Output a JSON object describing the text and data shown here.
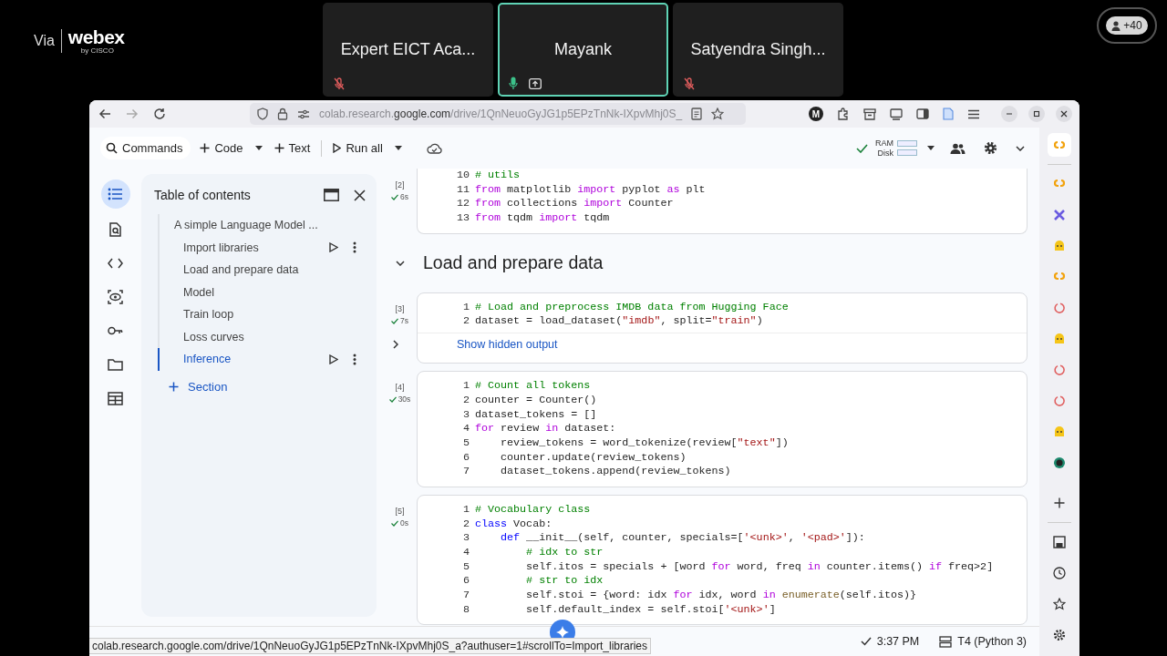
{
  "meeting": {
    "brand_prefix": "Via",
    "brand": "webex",
    "brand_sub": "by CISCO",
    "attendees_badge": "+40",
    "participants": [
      {
        "name": "Expert EICT Aca...",
        "muted": true,
        "speaking": false,
        "sharing": false
      },
      {
        "name": "Mayank",
        "muted": false,
        "speaking": true,
        "sharing": true
      },
      {
        "name": "Satyendra Singh...",
        "muted": true,
        "speaking": false,
        "sharing": false
      }
    ]
  },
  "browser": {
    "url": "colab.research.**google.com**/drive/1QnNeuoGyJG1p5EPzTnNk-IXpvMhj0S_",
    "profile_initial": "M",
    "status_link": "colab.research.google.com/drive/1QnNeuoGyJG1p5EPzTnNk-IXpvMhj0S_a?authuser=1#scrollTo=Import_libraries"
  },
  "toolbar": {
    "items": [
      {
        "kind": "search",
        "label": "Commands",
        "menu": false
      },
      {
        "kind": "add",
        "label": "Code",
        "menu": true
      },
      {
        "kind": "add",
        "label": "Text",
        "menu": false
      },
      {
        "kind": "run",
        "label": "Run all",
        "menu": true
      }
    ],
    "connected": true,
    "ram_label": "RAM",
    "disk_label": "Disk"
  },
  "sidebar": {
    "items": [
      {
        "kind": "toc",
        "selected": true
      },
      {
        "kind": "find",
        "selected": false
      },
      {
        "kind": "code",
        "selected": false
      },
      {
        "kind": "variables",
        "selected": false
      },
      {
        "kind": "secrets",
        "selected": false
      },
      {
        "kind": "files",
        "selected": false
      },
      {
        "kind": "data",
        "selected": false
      }
    ]
  },
  "toc": {
    "title": "Table of contents",
    "add_label": "Section",
    "items": [
      {
        "label": "A simple Language Model ...",
        "selected": false,
        "hovered": false,
        "children": [
          {
            "label": "Import libraries",
            "selected": false,
            "hovered": true
          },
          {
            "label": "Load and prepare data",
            "selected": false,
            "hovered": false
          },
          {
            "label": "Model",
            "selected": false,
            "hovered": false
          },
          {
            "label": "Train loop",
            "selected": false,
            "hovered": false
          },
          {
            "label": "Loss curves",
            "selected": false,
            "hovered": false
          },
          {
            "label": "Inference",
            "selected": true,
            "hovered": false
          }
        ]
      }
    ]
  },
  "notebook": {
    "blocks": [
      {
        "kind": "code",
        "count": "[2]",
        "time": "6s",
        "done": true,
        "lines": [
          {
            "number": "10",
            "tokens": [
              {
                "text": "# utils",
                "kind": "comment"
              }
            ]
          },
          {
            "number": "11",
            "tokens": [
              {
                "text": "from",
                "kind": "keyword"
              },
              {
                "text": " matplotlib ",
                "kind": "plain"
              },
              {
                "text": "import",
                "kind": "keyword"
              },
              {
                "text": " pyplot ",
                "kind": "plain"
              },
              {
                "text": "as",
                "kind": "keyword"
              },
              {
                "text": " plt",
                "kind": "plain"
              }
            ]
          },
          {
            "number": "12",
            "tokens": [
              {
                "text": "from",
                "kind": "keyword"
              },
              {
                "text": " collections ",
                "kind": "plain"
              },
              {
                "text": "import",
                "kind": "keyword"
              },
              {
                "text": " Counter",
                "kind": "plain"
              }
            ]
          },
          {
            "number": "13",
            "tokens": [
              {
                "text": "from",
                "kind": "keyword"
              },
              {
                "text": " tqdm ",
                "kind": "plain"
              },
              {
                "text": "import",
                "kind": "keyword"
              },
              {
                "text": " tqdm",
                "kind": "plain"
              }
            ]
          }
        ]
      },
      {
        "kind": "heading",
        "text": "Load and prepare data",
        "expanded": true
      },
      {
        "kind": "code",
        "count": "[3]",
        "time": "7s",
        "done": true,
        "hidden_output": "Show hidden output",
        "lines": [
          {
            "number": "1",
            "tokens": [
              {
                "text": "# Load and preprocess IMDB data from Hugging Face",
                "kind": "comment"
              }
            ]
          },
          {
            "number": "2",
            "tokens": [
              {
                "text": "dataset = load_dataset(",
                "kind": "plain"
              },
              {
                "text": "\"imdb\"",
                "kind": "string"
              },
              {
                "text": ", split=",
                "kind": "plain"
              },
              {
                "text": "\"train\"",
                "kind": "string"
              },
              {
                "text": ")",
                "kind": "plain"
              }
            ]
          }
        ]
      },
      {
        "kind": "code",
        "count": "[4]",
        "time": "30s",
        "done": true,
        "lines": [
          {
            "number": "1",
            "tokens": [
              {
                "text": "# Count all tokens",
                "kind": "comment"
              }
            ]
          },
          {
            "number": "2",
            "tokens": [
              {
                "text": "counter = Counter()",
                "kind": "plain"
              }
            ]
          },
          {
            "number": "3",
            "tokens": [
              {
                "text": "dataset_tokens = []",
                "kind": "plain"
              }
            ]
          },
          {
            "number": "4",
            "tokens": [
              {
                "text": "for",
                "kind": "keyword"
              },
              {
                "text": " review ",
                "kind": "plain"
              },
              {
                "text": "in",
                "kind": "keyword"
              },
              {
                "text": " dataset:",
                "kind": "plain"
              }
            ]
          },
          {
            "number": "5",
            "tokens": [
              {
                "text": "    review_tokens = word_tokenize(review[",
                "kind": "plain"
              },
              {
                "text": "\"text\"",
                "kind": "string"
              },
              {
                "text": "])",
                "kind": "plain"
              }
            ]
          },
          {
            "number": "6",
            "tokens": [
              {
                "text": "    counter.update(review_tokens)",
                "kind": "plain"
              }
            ]
          },
          {
            "number": "7",
            "tokens": [
              {
                "text": "    dataset_tokens.append(review_tokens)",
                "kind": "plain"
              }
            ]
          }
        ]
      },
      {
        "kind": "code",
        "count": "[5]",
        "time": "0s",
        "done": true,
        "lines": [
          {
            "number": "1",
            "tokens": [
              {
                "text": "# Vocabulary class",
                "kind": "comment"
              }
            ]
          },
          {
            "number": "2",
            "tokens": [
              {
                "text": "class",
                "kind": "declaration"
              },
              {
                "text": " Vocab:",
                "kind": "plain"
              }
            ]
          },
          {
            "number": "3",
            "tokens": [
              {
                "text": "    def",
                "kind": "declaration"
              },
              {
                "text": " __init__(self, counter, specials=[",
                "kind": "plain"
              },
              {
                "text": "'<unk>'",
                "kind": "string"
              },
              {
                "text": ", ",
                "kind": "plain"
              },
              {
                "text": "'<pad>'",
                "kind": "string"
              },
              {
                "text": "]):",
                "kind": "plain"
              }
            ]
          },
          {
            "number": "4",
            "tokens": [
              {
                "text": "        # idx to str",
                "kind": "comment"
              }
            ]
          },
          {
            "number": "5",
            "tokens": [
              {
                "text": "        self.itos = specials + [word ",
                "kind": "plain"
              },
              {
                "text": "for",
                "kind": "keyword"
              },
              {
                "text": " word, freq ",
                "kind": "plain"
              },
              {
                "text": "in",
                "kind": "keyword"
              },
              {
                "text": " counter.items() ",
                "kind": "plain"
              },
              {
                "text": "if",
                "kind": "keyword"
              },
              {
                "text": " freq>2]",
                "kind": "plain"
              }
            ]
          },
          {
            "number": "6",
            "tokens": [
              {
                "text": "        # str to idx",
                "kind": "comment"
              }
            ]
          },
          {
            "number": "7",
            "tokens": [
              {
                "text": "        self.stoi = {word: idx ",
                "kind": "plain"
              },
              {
                "text": "for",
                "kind": "keyword"
              },
              {
                "text": " idx, word ",
                "kind": "plain"
              },
              {
                "text": "in",
                "kind": "keyword"
              },
              {
                "text": " enumerate",
                "kind": "builtin"
              },
              {
                "text": "(self.itos)}",
                "kind": "plain"
              }
            ]
          },
          {
            "number": "8",
            "tokens": [
              {
                "text": "        self.default_index = self.stoi[",
                "kind": "plain"
              },
              {
                "text": "'<unk>'",
                "kind": "string"
              },
              {
                "text": "]",
                "kind": "plain"
              }
            ]
          }
        ]
      }
    ]
  },
  "status_bar": {
    "time": "3:37 PM",
    "runtime": "T4 (Python 3)"
  }
}
